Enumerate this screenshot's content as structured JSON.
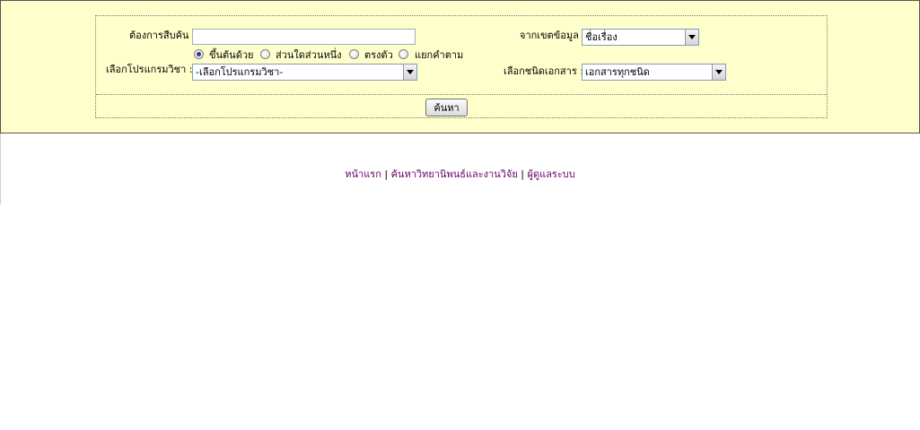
{
  "search_form": {
    "keyword_label": "ต้องการสืบค้น :",
    "keyword_value": "",
    "scope_label": "จากเขตข้อมูล :",
    "scope_selected": "ชื่อเรื่อง",
    "match_options": [
      {
        "label": "ขึ้นต้นด้วย",
        "checked": true
      },
      {
        "label": "ส่วนใดส่วนหนึ่ง",
        "checked": false
      },
      {
        "label": "ตรงตัว",
        "checked": false
      },
      {
        "label": "แยกคำตาม",
        "checked": false
      }
    ],
    "program_label": "เลือกโปรแกรมวิชา :",
    "program_selected": "-เลือกโปรแกรมวิชา-",
    "doctype_label": "เลือกชนิดเอกสาร :",
    "doctype_selected": "เอกสารทุกชนิด",
    "submit_label": "ค้นหา"
  },
  "footer": {
    "links": [
      "หน้าแรก",
      "ค้นหาวิทยานิพนธ์และงานวิจัย",
      "ผู้ดูแลระบบ"
    ],
    "separator": " | "
  },
  "colors": {
    "panel_background": "#ffffcc",
    "link_color": "#660066"
  }
}
